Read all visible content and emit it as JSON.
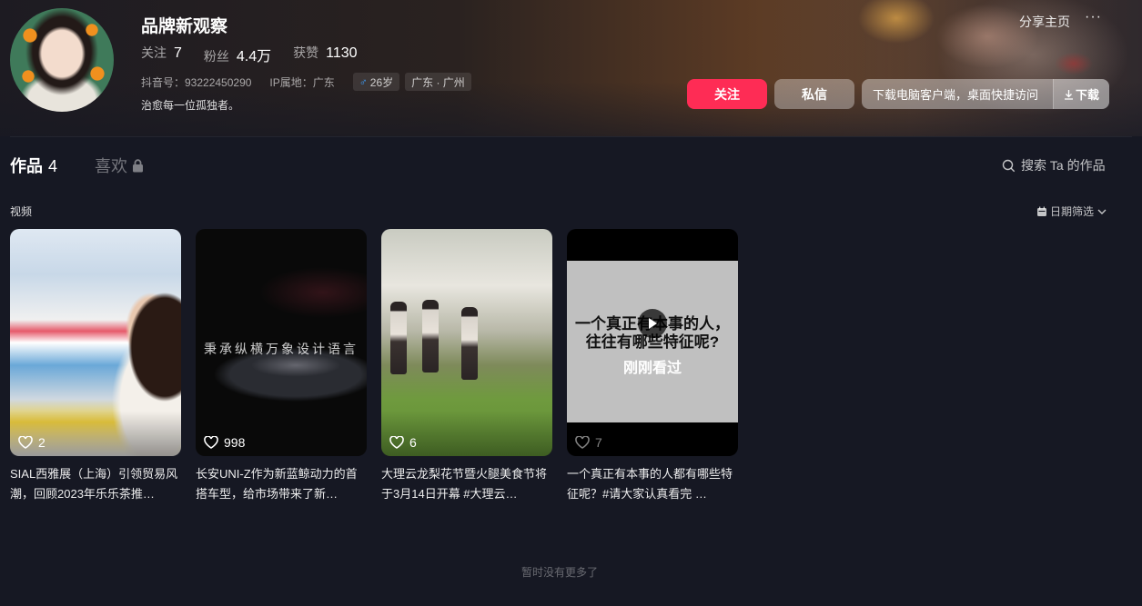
{
  "profile": {
    "name": "品牌新观察",
    "following_label": "关注",
    "following_count": "7",
    "fans_label": "粉丝",
    "fans_count": "4.4万",
    "likes_label": "获赞",
    "likes_count": "1130",
    "douyin_id": "抖音号：93222450290",
    "ip_location": "IP属地：广东",
    "age_tag": "26岁",
    "gender_symbol": "♂",
    "region_tag": "广东 · 广州",
    "bio": "治愈每一位孤独者。"
  },
  "header_actions": {
    "share": "分享主页",
    "more": "···",
    "follow": "关注",
    "message": "私信",
    "download_text": "下载电脑客户端，桌面快捷访问",
    "download_btn": "下载"
  },
  "tabs": {
    "works_label": "作品",
    "works_count": "4",
    "likes_label": "喜欢"
  },
  "search": {
    "label": "搜索 Ta 的作品"
  },
  "section": {
    "label": "视频",
    "date_filter": "日期筛选"
  },
  "videos": [
    {
      "likes": "2",
      "title": "SIAL西雅展（上海）引领贸易风潮，回顾2023年乐乐茶推…"
    },
    {
      "likes": "998",
      "title": "长安UNI-Z作为新蓝鲸动力的首搭车型，给市场带来了新…",
      "overlay": "秉承纵横万象设计语言"
    },
    {
      "likes": "6",
      "title": "大理云龙梨花节暨火腿美食节将于3月14日开幕 #大理云…"
    },
    {
      "likes": "7",
      "title": "一个真正有本事的人都有哪些特征呢？#请大家认真看完 …",
      "overlay_line1": "一个真正有本事的人，",
      "overlay_line2": "往往有哪些特征呢?",
      "watched": "刚刚看过"
    }
  ],
  "footer": {
    "no_more": "暂时没有更多了"
  },
  "colors": {
    "accent": "#fe2c55",
    "background": "#161823"
  }
}
